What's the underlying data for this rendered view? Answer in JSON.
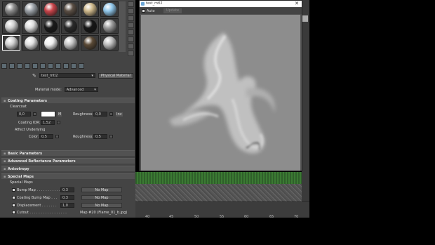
{
  "editor": {
    "material_name": "test_mtl2",
    "material_type": "Physical Material",
    "material_mode_label": "Material mode:",
    "material_mode_value": "Advanced",
    "slots": [
      {
        "color": "#8a8a8a"
      },
      {
        "color": "#9aa0a6"
      },
      {
        "color": "#c8444a"
      },
      {
        "color": "#5a4e44"
      },
      {
        "color": "#cdb78a"
      },
      {
        "color": "#8fc5e8"
      },
      {
        "color": "#cfcfcf"
      },
      {
        "color": "#dcdcdc"
      },
      {
        "color": "#1a1a1a"
      },
      {
        "color": "#2a2a2a"
      },
      {
        "color": "#161616"
      },
      {
        "color": "#9a9a9a"
      },
      {
        "color": "#d0d0d0"
      },
      {
        "color": "#e0e0e0"
      },
      {
        "color": "#f0f0f0"
      },
      {
        "color": "#c5c5c5"
      },
      {
        "color": "#5b4a36"
      },
      {
        "color": "#bdbdbd"
      }
    ]
  },
  "coating": {
    "title": "Coating Parameters",
    "clearcoat_label": "Clearcoat",
    "clearcoat_value": "0,0",
    "m_label": "M",
    "roughness_label": "Roughness:",
    "roughness_value": "0,0",
    "inv_label": "Inv",
    "ior_label": "Coating IOR:",
    "ior_value": "1,52",
    "affect_label": "Affect Underlying",
    "color_label": "Color:",
    "color_value": "0,5",
    "roughness2_label": "Roughness:",
    "roughness2_value": "0,5"
  },
  "rollouts": {
    "basic": "Basic Parameters",
    "advanced": "Advanced Reflectance Parameters",
    "anisotropy": "Anisotropy",
    "special": "Special Maps"
  },
  "special_maps": {
    "header": "Special Maps",
    "rows": [
      {
        "label": "Bump Map . . . . . . . . . . .",
        "value": "0,3",
        "map": "No Map"
      },
      {
        "label": "Coating Bump Map . . .",
        "value": "0,3",
        "map": "No Map"
      },
      {
        "label": "Displacement . . . . . . .",
        "value": "1,0",
        "map": "No Map"
      },
      {
        "label": "Cutout . . . . . . . . . . . . . . . . .",
        "value": "",
        "map": "Map #20 (Flame_01_b.jpg)"
      }
    ]
  },
  "preview": {
    "title": "test_mtl2",
    "auto_label": "Auto",
    "update_label": "Update",
    "close": "✕"
  },
  "timeline": {
    "ticks": [
      "40",
      "45",
      "50",
      "55",
      "60",
      "65",
      "70"
    ]
  }
}
